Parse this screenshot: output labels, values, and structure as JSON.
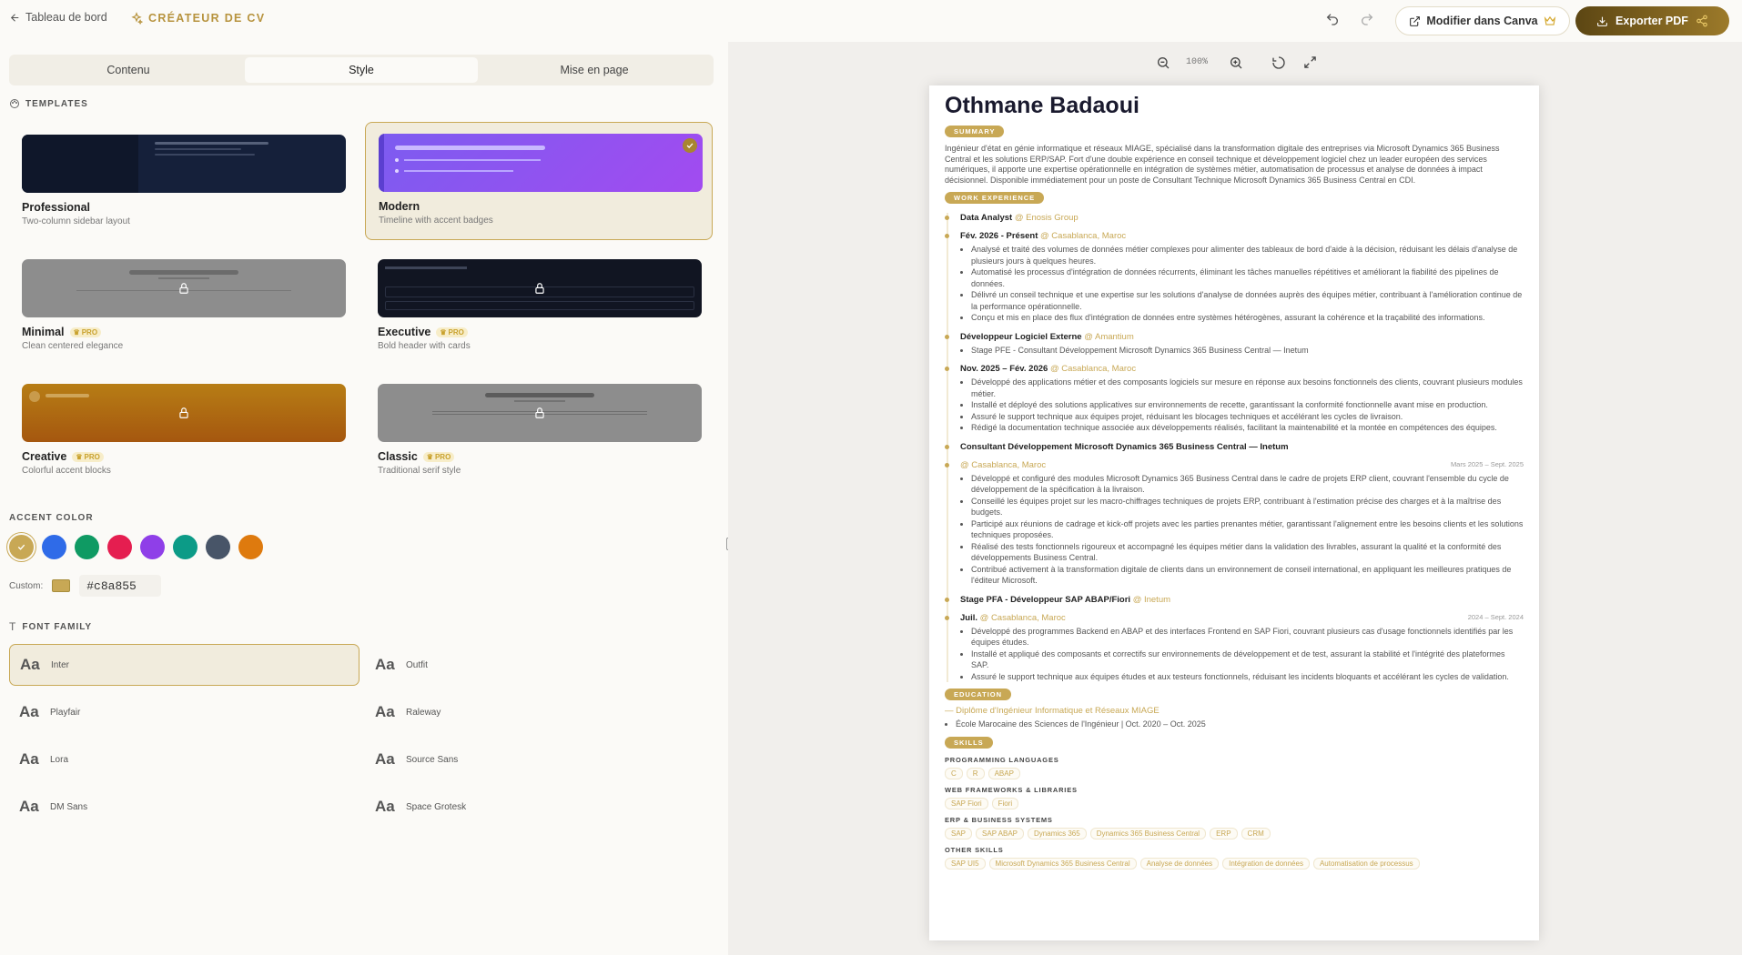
{
  "topbar": {
    "back_label": "Tableau de bord",
    "brand_label": "CRÉATEUR DE CV",
    "canva_label": "Modifier dans Canva",
    "export_label": "Exporter PDF"
  },
  "tabs": [
    {
      "label": "Contenu"
    },
    {
      "label": "Style"
    },
    {
      "label": "Mise en page"
    }
  ],
  "templates_title": "TEMPLATES",
  "templates": [
    {
      "name": "Professional",
      "desc": "Two-column sidebar layout"
    },
    {
      "name": "Modern",
      "desc": "Timeline with accent badges"
    },
    {
      "name": "Minimal",
      "desc": "Clean centered elegance"
    },
    {
      "name": "Executive",
      "desc": "Bold header with cards"
    },
    {
      "name": "Creative",
      "desc": "Colorful accent blocks"
    },
    {
      "name": "Classic",
      "desc": "Traditional serif style"
    }
  ],
  "pro_label": "PRO",
  "accent_title": "ACCENT COLOR",
  "accent_colors": [
    "#c8a855",
    "#2f6be8",
    "#0f9a63",
    "#e51e50",
    "#8f3fe8",
    "#0c9b87",
    "#485568",
    "#de7a0e"
  ],
  "custom_label": "Custom:",
  "custom_hex": "#c8a855",
  "font_title": "FONT FAMILY",
  "font_sample": "Aa",
  "fonts": [
    {
      "name": "Inter"
    },
    {
      "name": "Outfit"
    },
    {
      "name": "Playfair"
    },
    {
      "name": "Raleway"
    },
    {
      "name": "Lora"
    },
    {
      "name": "Source Sans"
    },
    {
      "name": "DM Sans"
    },
    {
      "name": "Space Grotesk"
    }
  ],
  "zoom_level": "100%",
  "cv": {
    "name": "Othmane Badaoui",
    "summary_label": "SUMMARY",
    "summary": "Ingénieur d'état en génie informatique et réseaux MIAGE, spécialisé dans la transformation digitale des entreprises via Microsoft Dynamics 365 Business Central et les solutions ERP/SAP. Fort d'une double expérience en conseil technique et développement logiciel chez un leader européen des services numériques, il apporte une expertise opérationnelle en intégration de systèmes métier, automatisation de processus et analyse de données à impact décisionnel. Disponible immédiatement pour un poste de Consultant Technique Microsoft Dynamics 365 Business Central en CDI.",
    "work_label": "WORK EXPERIENCE",
    "jobs": [
      {
        "title": "Data Analyst",
        "loc": "@ Enosis Group",
        "dates": "",
        "bullets": []
      },
      {
        "title": "Fév. 2026 - Présent",
        "loc": "@ Casablanca, Maroc",
        "dates": "",
        "bullets": [
          "Analysé et traité des volumes de données métier complexes pour alimenter des tableaux de bord d'aide à la décision, réduisant les délais d'analyse de plusieurs jours à quelques heures.",
          "Automatisé les processus d'intégration de données récurrents, éliminant les tâches manuelles répétitives et améliorant la fiabilité des pipelines de données.",
          "Délivré un conseil technique et une expertise sur les solutions d'analyse de données auprès des équipes métier, contribuant à l'amélioration continue de la performance opérationnelle.",
          "Conçu et mis en place des flux d'intégration de données entre systèmes hétérogènes, assurant la cohérence et la traçabilité des informations."
        ]
      },
      {
        "title": "Développeur Logiciel Externe",
        "loc": "@ Amantium",
        "dates": "",
        "bullets": [
          "Stage PFE - Consultant Développement Microsoft Dynamics 365 Business Central — Inetum"
        ]
      },
      {
        "title": "Nov. 2025 – Fév. 2026",
        "loc": "@ Casablanca, Maroc",
        "dates": "",
        "bullets": [
          "Développé des applications métier et des composants logiciels sur mesure en réponse aux besoins fonctionnels des clients, couvrant plusieurs modules métier.",
          "Installé et déployé des solutions applicatives sur environnements de recette, garantissant la conformité fonctionnelle avant mise en production.",
          "Assuré le support technique aux équipes projet, réduisant les blocages techniques et accélérant les cycles de livraison.",
          "Rédigé la documentation technique associée aux développements réalisés, facilitant la maintenabilité et la montée en compétences des équipes."
        ]
      },
      {
        "title": "Consultant Développement Microsoft Dynamics 365 Business Central — Inetum",
        "loc": "",
        "dates": "",
        "bullets": []
      },
      {
        "title": "",
        "loc": "@ Casablanca, Maroc",
        "dates": "Mars 2025 – Sept. 2025",
        "bullets": [
          "Développé et configuré des modules Microsoft Dynamics 365 Business Central dans le cadre de projets ERP client, couvrant l'ensemble du cycle de développement de la spécification à la livraison.",
          "Conseillé les équipes projet sur les macro-chiffrages techniques de projets ERP, contribuant à l'estimation précise des charges et à la maîtrise des budgets.",
          "Participé aux réunions de cadrage et kick-off projets avec les parties prenantes métier, garantissant l'alignement entre les besoins clients et les solutions techniques proposées.",
          "Réalisé des tests fonctionnels rigoureux et accompagné les équipes métier dans la validation des livrables, assurant la qualité et la conformité des développements Business Central.",
          "Contribué activement à la transformation digitale de clients dans un environnement de conseil international, en appliquant les meilleures pratiques de l'éditeur Microsoft."
        ]
      },
      {
        "title": "Stage PFA - Développeur SAP ABAP/Fiori",
        "loc": "@ Inetum",
        "dates": "",
        "bullets": []
      },
      {
        "title": "Juil.",
        "loc": "@ Casablanca, Maroc",
        "dates": "2024 – Sept. 2024",
        "bullets": [
          "Développé des programmes Backend en ABAP et des interfaces Frontend en SAP Fiori, couvrant plusieurs cas d'usage fonctionnels identifiés par les équipes études.",
          "Installé et appliqué des composants et correctifs sur environnements de développement et de test, assurant la stabilité et l'intégrité des plateformes SAP.",
          "Assuré le support technique aux équipes études et aux testeurs fonctionnels, réduisant les incidents bloquants et accélérant les cycles de validation."
        ]
      }
    ],
    "education_label": "EDUCATION",
    "education_title": "— Diplôme d'Ingénieur Informatique et Réseaux MIAGE",
    "education_school": "École Marocaine des Sciences de l'Ingénieur | Oct. 2020 – Oct. 2025",
    "skills_label": "SKILLS",
    "skill_groups": [
      {
        "title": "PROGRAMMING LANGUAGES",
        "items": [
          "C",
          "R",
          "ABAP"
        ]
      },
      {
        "title": "WEB FRAMEWORKS & LIBRARIES",
        "items": [
          "SAP Fiori",
          "Fiori"
        ]
      },
      {
        "title": "ERP & BUSINESS SYSTEMS",
        "items": [
          "SAP",
          "SAP ABAP",
          "Dynamics 365",
          "Dynamics 365 Business Central",
          "ERP",
          "CRM"
        ]
      },
      {
        "title": "OTHER SKILLS",
        "items": [
          "SAP UI5",
          "Microsoft Dynamics 365 Business Central",
          "Analyse de données",
          "Intégration de données",
          "Automatisation de processus"
        ]
      }
    ]
  }
}
